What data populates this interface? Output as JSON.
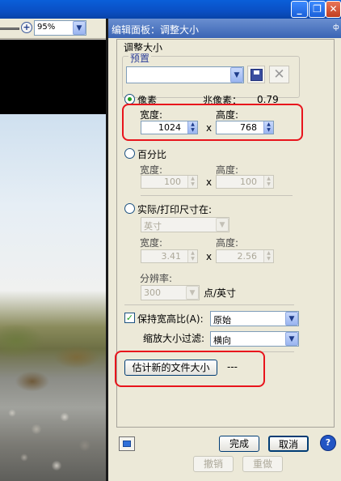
{
  "window": {
    "minimize_icon": "minimize-icon",
    "maximize_icon": "restore-icon",
    "close_icon": "close-icon"
  },
  "image_area": {
    "zoom_value": "95%"
  },
  "panel": {
    "title": "编辑面板：调整大小",
    "pin_glyph": "ф",
    "section_title": "调整大小",
    "preset": {
      "label": "预置",
      "value": ""
    },
    "pixels": {
      "label": "像素",
      "megapixels_label": "兆像素：",
      "megapixels_value": "0.79",
      "width_label": "宽度:",
      "height_label": "高度:",
      "width": "1024",
      "height": "768",
      "times": "x"
    },
    "percent": {
      "label": "百分比",
      "width_label": "宽度:",
      "height_label": "高度:",
      "width": "100",
      "height": "100",
      "times": "x"
    },
    "actual": {
      "label": "实际/打印尺寸在:",
      "unit": "英寸",
      "width_label": "宽度:",
      "height_label": "高度:",
      "width": "3.41",
      "height": "2.56",
      "times": "x",
      "resolution_label": "分辨率:",
      "resolution": "300",
      "resolution_unit": "点/英寸"
    },
    "keep_ratio": {
      "label": "保持宽高比(A):",
      "value": "原始",
      "checked": true
    },
    "filter": {
      "label": "缩放大小过滤:",
      "value": "横向"
    },
    "estimate": {
      "button": "估计新的文件大小",
      "result": "---"
    },
    "buttons": {
      "done": "完成",
      "cancel": "取消",
      "help": "?",
      "undo": "撤销",
      "redo": "重做"
    }
  }
}
